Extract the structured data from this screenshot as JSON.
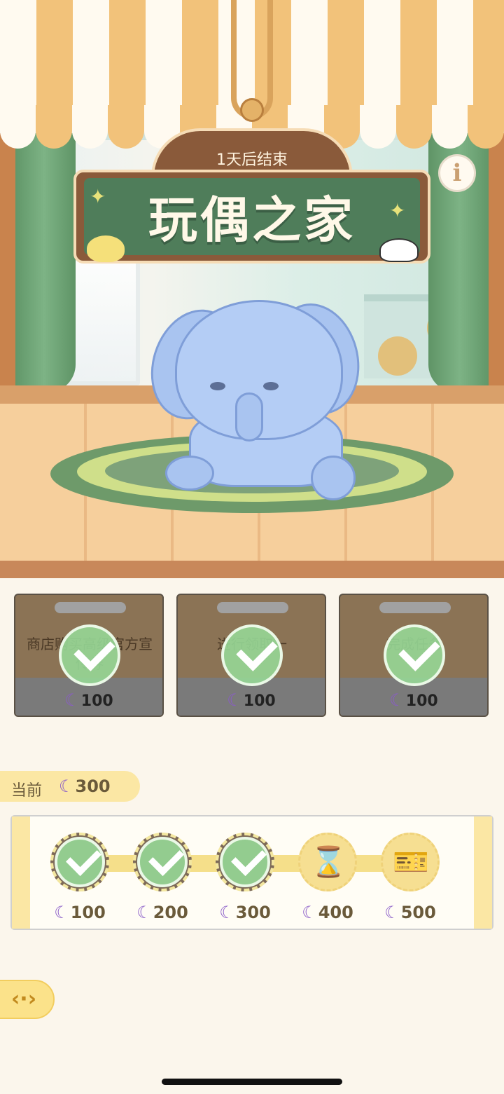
{
  "event": {
    "countdown": "1天后结束",
    "title": "玩偶之家"
  },
  "tasks": [
    {
      "description": "商店购买高级官方宣传券",
      "reward": "100",
      "completed": true
    },
    {
      "description": "进行领取一",
      "reward": "100",
      "completed": true
    },
    {
      "description": "完成任务",
      "reward": "100",
      "completed": true
    }
  ],
  "progress": {
    "current_label": "当前",
    "current_value": "300",
    "milestones": [
      {
        "value": "100",
        "claimed": true,
        "icon": "check-icon"
      },
      {
        "value": "200",
        "claimed": true,
        "icon": "check-icon"
      },
      {
        "value": "300",
        "claimed": true,
        "icon": "check-icon"
      },
      {
        "value": "400",
        "claimed": false,
        "icon": "hourglass-icon"
      },
      {
        "value": "500",
        "claimed": false,
        "icon": "ticket-icon"
      }
    ]
  },
  "colors": {
    "moon_currency": "#8a5cc8",
    "check": "#96d796",
    "sign_green": "#4f7d5a"
  }
}
